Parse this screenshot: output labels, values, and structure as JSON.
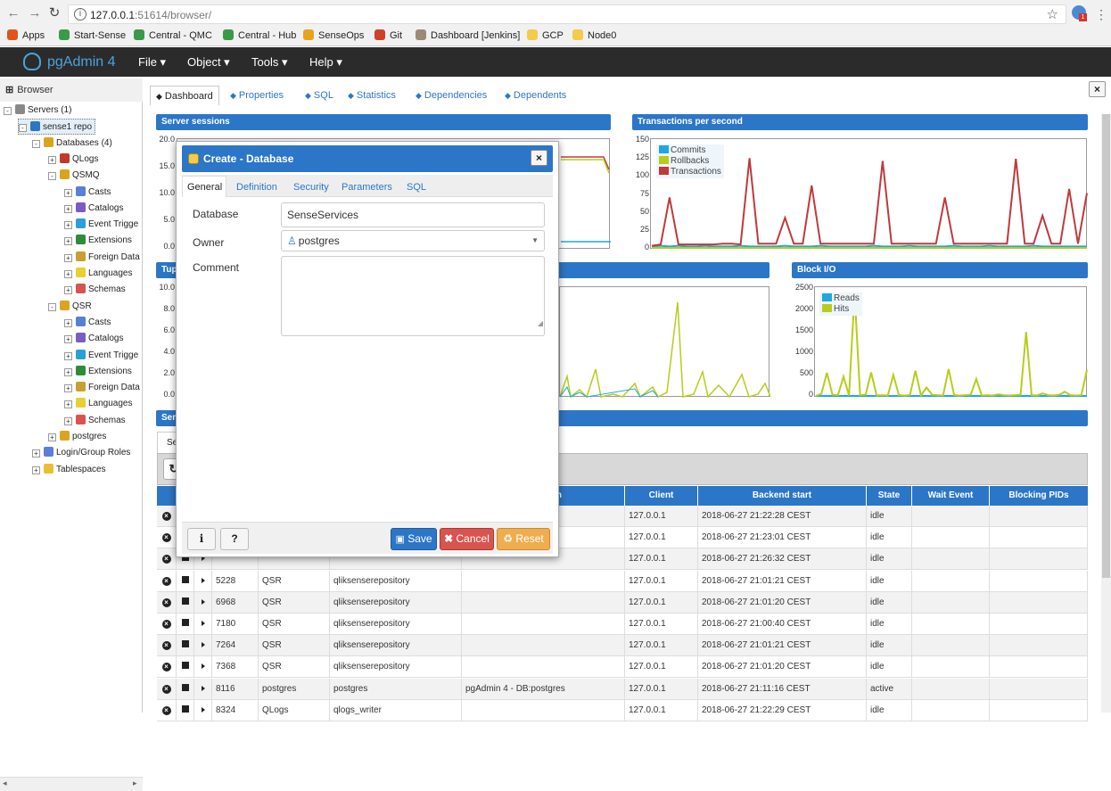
{
  "browser_chrome": {
    "url_host": "127.0.0.1",
    "url_rest": ":51614/browser/",
    "bookmarks": [
      {
        "label": "Apps",
        "icon": "apps-grid-icon",
        "color": "#e0531c"
      },
      {
        "label": "Start-Sense",
        "icon": "qlik-icon",
        "color": "#3b9a49"
      },
      {
        "label": "Central - QMC",
        "icon": "qlik-icon",
        "color": "#3b9a49"
      },
      {
        "label": "Central - Hub",
        "icon": "qlik-icon",
        "color": "#3b9a49"
      },
      {
        "label": "SenseOps",
        "icon": "gear-icon",
        "color": "#e8a31c"
      },
      {
        "label": "Git",
        "icon": "git-icon",
        "color": "#d14028"
      },
      {
        "label": "Dashboard [Jenkins]",
        "icon": "jenkins-icon",
        "color": "#9a8a78"
      },
      {
        "label": "GCP",
        "icon": "folder-icon",
        "color": "#f2cc4a"
      },
      {
        "label": "Node0",
        "icon": "folder-icon",
        "color": "#f2cc4a"
      }
    ]
  },
  "app": {
    "brand": "pgAdmin 4",
    "menus": [
      "File ▾",
      "Object ▾",
      "Tools ▾",
      "Help ▾"
    ]
  },
  "browser_panel": {
    "title": "Browser",
    "tree": [
      {
        "label": "Servers (1)",
        "depth": 0,
        "icon": "server-group-icon",
        "color": "#888888",
        "expand": "-"
      },
      {
        "label": "sense1 repo",
        "depth": 1,
        "icon": "server-icon",
        "color": "#2c76c7",
        "expand": "-"
      },
      {
        "label": "Databases (4)",
        "depth": 2,
        "icon": "databases-icon",
        "color": "#d9a520",
        "expand": "-"
      },
      {
        "label": "QLogs",
        "depth": 3,
        "icon": "database-icon",
        "color": "#c0392b",
        "expand": "+"
      },
      {
        "label": "QSMQ",
        "depth": 3,
        "icon": "database-icon",
        "color": "#d9a520",
        "expand": "-"
      },
      {
        "label": "Casts",
        "depth": 4,
        "icon": "casts-icon",
        "color": "#5b7fd6",
        "expand": "+"
      },
      {
        "label": "Catalogs",
        "depth": 4,
        "icon": "catalogs-icon",
        "color": "#7b5cc4",
        "expand": "+"
      },
      {
        "label": "Event Trigge",
        "depth": 4,
        "icon": "event-trigger-icon",
        "color": "#2c9ed9",
        "expand": "+"
      },
      {
        "label": "Extensions",
        "depth": 4,
        "icon": "extensions-icon",
        "color": "#2e8b3a",
        "expand": "+"
      },
      {
        "label": "Foreign Data",
        "depth": 4,
        "icon": "foreign-data-icon",
        "color": "#c8a030",
        "expand": "+"
      },
      {
        "label": "Languages",
        "depth": 4,
        "icon": "languages-icon",
        "color": "#e8d030",
        "expand": "+"
      },
      {
        "label": "Schemas",
        "depth": 4,
        "icon": "schemas-icon",
        "color": "#d9534f",
        "expand": "+"
      },
      {
        "label": "QSR",
        "depth": 3,
        "icon": "database-icon",
        "color": "#d9a520",
        "expand": "-"
      },
      {
        "label": "Casts",
        "depth": 4,
        "icon": "casts-icon",
        "color": "#5b7fd6",
        "expand": "+"
      },
      {
        "label": "Catalogs",
        "depth": 4,
        "icon": "catalogs-icon",
        "color": "#7b5cc4",
        "expand": "+"
      },
      {
        "label": "Event Trigge",
        "depth": 4,
        "icon": "event-trigger-icon",
        "color": "#2c9ed9",
        "expand": "+"
      },
      {
        "label": "Extensions",
        "depth": 4,
        "icon": "extensions-icon",
        "color": "#2e8b3a",
        "expand": "+"
      },
      {
        "label": "Foreign Data",
        "depth": 4,
        "icon": "foreign-data-icon",
        "color": "#c8a030",
        "expand": "+"
      },
      {
        "label": "Languages",
        "depth": 4,
        "icon": "languages-icon",
        "color": "#e8d030",
        "expand": "+"
      },
      {
        "label": "Schemas",
        "depth": 4,
        "icon": "schemas-icon",
        "color": "#d9534f",
        "expand": "+"
      },
      {
        "label": "postgres",
        "depth": 3,
        "icon": "database-icon",
        "color": "#d9a520",
        "expand": "+"
      },
      {
        "label": "Login/Group Roles",
        "depth": 2,
        "icon": "roles-icon",
        "color": "#5b7fd6",
        "expand": "+"
      },
      {
        "label": "Tablespaces",
        "depth": 2,
        "icon": "tablespaces-icon",
        "color": "#e8c030",
        "expand": "+"
      }
    ]
  },
  "tabs": [
    "Dashboard",
    "Properties",
    "SQL",
    "Statistics",
    "Dependencies",
    "Dependents"
  ],
  "tab_icons": [
    "dashboard-icon",
    "properties-icon",
    "sql-icon",
    "statistics-icon",
    "dependencies-icon",
    "dependents-icon"
  ],
  "sections": {
    "server_sessions": "Server sessions",
    "tps": "Transactions per second",
    "tuples_partial": "Tup",
    "block_io": "Block I/O",
    "server_activity_partial": "Serv",
    "sessions_tab_partial": "Se"
  },
  "charts": {
    "sessions_ticks": [
      "20.0",
      "15.0",
      "10.0",
      "5.0",
      "0.0"
    ],
    "tps_ticks": [
      "150",
      "125",
      "100",
      "75",
      "50",
      "25",
      "0"
    ],
    "tuples_ticks": [
      "10.0",
      "8.0",
      "6.0",
      "4.0",
      "2.0",
      "0.0"
    ],
    "block_ticks": [
      "2500",
      "2000",
      "1500",
      "1000",
      "500",
      "0"
    ]
  },
  "chart_data": [
    {
      "type": "line",
      "title": "Transactions per second",
      "ylim": [
        0,
        150
      ],
      "legend": "top-left",
      "series": [
        {
          "name": "Commits",
          "color": "#1ea7e1",
          "values": [
            2,
            3,
            2,
            3,
            2,
            2,
            3,
            2,
            2,
            2,
            3,
            2,
            2,
            2,
            2,
            3,
            2,
            2,
            2,
            3,
            2,
            2,
            2,
            2,
            2,
            3,
            2,
            2,
            2,
            3,
            2,
            2,
            2,
            2,
            3,
            2,
            2,
            2,
            3,
            2,
            2,
            2,
            2,
            3,
            2,
            2,
            2,
            2,
            2,
            2
          ]
        },
        {
          "name": "Rollbacks",
          "color": "#b8cc1a",
          "values": [
            0,
            0,
            0,
            0,
            0,
            0,
            0,
            0,
            0,
            0,
            0,
            0,
            0,
            0,
            0,
            0,
            0,
            0,
            0,
            0,
            0,
            0,
            0,
            0,
            0,
            0,
            0,
            0,
            0,
            0,
            0,
            0,
            0,
            0,
            0,
            0,
            0,
            0,
            0,
            0,
            0,
            0,
            0,
            0,
            0,
            0,
            0,
            0,
            0,
            0
          ]
        },
        {
          "name": "Transactions",
          "color": "#c0393b",
          "values": [
            3,
            5,
            72,
            5,
            5,
            5,
            5,
            5,
            6,
            6,
            5,
            128,
            6,
            6,
            6,
            43,
            6,
            6,
            89,
            6,
            6,
            6,
            6,
            6,
            6,
            6,
            124,
            6,
            6,
            6,
            6,
            6,
            6,
            72,
            6,
            6,
            6,
            6,
            6,
            6,
            6,
            127,
            6,
            6,
            46,
            6,
            6,
            84,
            6,
            78
          ]
        }
      ]
    },
    {
      "type": "line",
      "title": "Block I/O",
      "ylim": [
        0,
        2500
      ],
      "legend": "top-left",
      "series": [
        {
          "name": "Reads",
          "color": "#1ea7e1",
          "values": [
            0,
            0,
            0,
            0,
            0,
            0,
            0,
            0,
            0,
            0,
            0,
            0,
            0,
            0,
            0,
            0,
            0,
            0,
            0,
            0,
            0,
            0,
            0,
            0,
            0,
            0,
            0,
            0,
            0,
            0,
            0,
            0,
            0,
            0,
            0,
            0,
            0,
            0,
            0,
            0,
            0,
            0,
            0,
            0,
            0,
            0,
            0,
            0,
            0,
            0
          ]
        },
        {
          "name": "Hits",
          "color": "#b8cc1a",
          "values": [
            0,
            50,
            550,
            30,
            20,
            460,
            10,
            2450,
            20,
            30,
            560,
            10,
            20,
            10,
            500,
            20,
            10,
            20,
            600,
            10,
            200,
            30,
            20,
            10,
            640,
            20,
            10,
            20,
            30,
            400,
            10,
            20,
            10,
            40,
            20,
            10,
            20,
            30,
            1520,
            20,
            10,
            60,
            20,
            10,
            30,
            100,
            20,
            10,
            20,
            620
          ]
        }
      ]
    }
  ],
  "table": {
    "headers_visible": [
      "n",
      "Client",
      "Backend start",
      "State",
      "Wait Event",
      "Blocking PIDs"
    ],
    "rows": [
      {
        "pid": "",
        "db": "",
        "user": "",
        "app": "",
        "client": "127.0.0.1",
        "start": "2018-06-27 21:22:28 CEST",
        "state": "idle",
        "hidden": true
      },
      {
        "pid": "",
        "db": "",
        "user": "",
        "app": "",
        "client": "127.0.0.1",
        "start": "2018-06-27 21:23:01 CEST",
        "state": "idle",
        "hidden": true
      },
      {
        "pid": "",
        "db": "",
        "user": "",
        "app": "",
        "client": "127.0.0.1",
        "start": "2018-06-27 21:26:32 CEST",
        "state": "idle",
        "hidden": true
      },
      {
        "pid": "5228",
        "db": "QSR",
        "user": "qliksenserepository",
        "app": "",
        "client": "127.0.0.1",
        "start": "2018-06-27 21:01:21 CEST",
        "state": "idle"
      },
      {
        "pid": "6968",
        "db": "QSR",
        "user": "qliksenserepository",
        "app": "",
        "client": "127.0.0.1",
        "start": "2018-06-27 21:01:20 CEST",
        "state": "idle"
      },
      {
        "pid": "7180",
        "db": "QSR",
        "user": "qliksenserepository",
        "app": "",
        "client": "127.0.0.1",
        "start": "2018-06-27 21:00:40 CEST",
        "state": "idle"
      },
      {
        "pid": "7264",
        "db": "QSR",
        "user": "qliksenserepository",
        "app": "",
        "client": "127.0.0.1",
        "start": "2018-06-27 21:01:21 CEST",
        "state": "idle"
      },
      {
        "pid": "7368",
        "db": "QSR",
        "user": "qliksenserepository",
        "app": "",
        "client": "127.0.0.1",
        "start": "2018-06-27 21:01:20 CEST",
        "state": "idle"
      },
      {
        "pid": "8116",
        "db": "postgres",
        "user": "postgres",
        "app": "pgAdmin 4 - DB:postgres",
        "client": "127.0.0.1",
        "start": "2018-06-27 21:11:16 CEST",
        "state": "active"
      },
      {
        "pid": "8324",
        "db": "QLogs",
        "user": "qlogs_writer",
        "app": "",
        "client": "127.0.0.1",
        "start": "2018-06-27 21:22:29 CEST",
        "state": "idle"
      }
    ]
  },
  "modal": {
    "title": "Create - Database",
    "tabs": [
      "General",
      "Definition",
      "Security",
      "Parameters",
      "SQL"
    ],
    "database_label": "Database",
    "database_value": "SenseServices",
    "owner_label": "Owner",
    "owner_value": "postgres",
    "comment_label": "Comment",
    "comment_value": "",
    "info_btn": "i",
    "help_btn": "?",
    "save": "Save",
    "cancel": "Cancel",
    "reset": "Reset",
    "colors": {
      "save": "#2c76c7",
      "cancel": "#d9534f",
      "reset": "#f0ad4e"
    }
  }
}
